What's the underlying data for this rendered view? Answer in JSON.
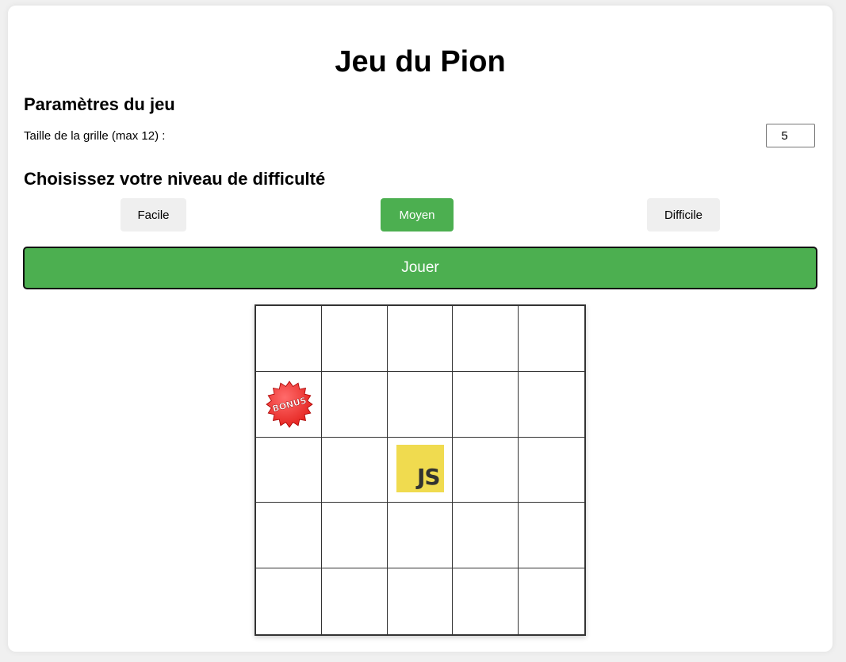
{
  "title": "Jeu du Pion",
  "settings": {
    "heading": "Paramètres du jeu",
    "grid_size_label": "Taille de la grille (max 12) :",
    "grid_size_value": "5"
  },
  "difficulty": {
    "heading": "Choisissez votre niveau de difficulté",
    "options": [
      "Facile",
      "Moyen",
      "Difficile"
    ],
    "selected": "Moyen"
  },
  "play_button": "Jouer",
  "board": {
    "size": 5,
    "bonus": {
      "row": 2,
      "col": 1,
      "label": "BONUS"
    },
    "player": {
      "row": 3,
      "col": 3,
      "label": "JS"
    }
  },
  "colors": {
    "accent": "#4caf50",
    "button_default": "#efefef",
    "js_yellow": "#f0db4f",
    "bonus_red": "#e3201b"
  }
}
